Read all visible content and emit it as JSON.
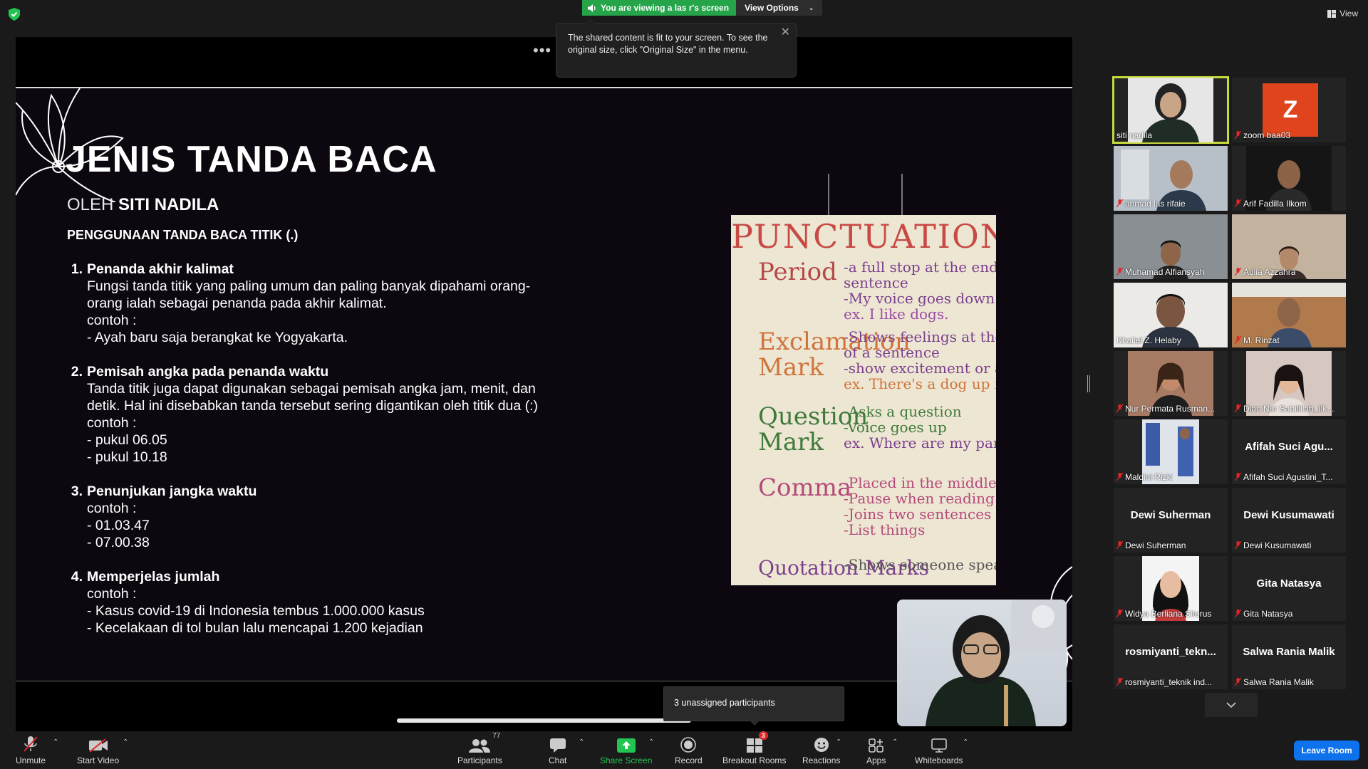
{
  "banner": {
    "viewing_text": "You are viewing a las r's screen",
    "view_options_label": "View Options",
    "view_label": "View"
  },
  "tooltip": {
    "text": "The shared content is fit to your screen. To see the original size, click \"Original Size\" in the menu."
  },
  "slide": {
    "title": "JENIS TANDA BACA",
    "author_prefix": "OLEH",
    "author_name": "SITI NADILA",
    "subtitle": "PENGGUNAAN TANDA BACA TITIK (.)",
    "items": [
      {
        "num": "1.",
        "heading": "Penanda akhir kalimat",
        "lines": [
          "Fungsi tanda titik yang paling umum dan paling banyak dipahami orang-",
          "orang ialah sebagai penanda pada akhir kalimat.",
          "contoh :",
          "- Ayah baru saja berangkat ke Yogyakarta."
        ]
      },
      {
        "num": "2.",
        "heading": "Pemisah angka pada penanda waktu",
        "lines": [
          "Tanda titik juga dapat digunakan sebagai pemisah angka jam, menit, dan",
          "detik. Hal ini disebabkan tanda tersebut sering digantikan oleh titik dua (:)",
          "contoh :",
          "- pukul 06.05",
          "- pukul 10.18"
        ]
      },
      {
        "num": "3.",
        "heading": "Penunjukan jangka waktu",
        "lines": [
          "contoh :",
          "- 01.03.47",
          "- 07.00.38"
        ]
      },
      {
        "num": "4.",
        "heading": "Memperjelas jumlah",
        "lines": [
          "contoh :",
          "- Kasus covid-19 di Indonesia tembus 1.000.000 kasus",
          "- Kecelakaan di tol bulan lalu mencapai 1.200 kejadian"
        ]
      }
    ]
  },
  "poster": {
    "heading": "PUNCTUATION",
    "rows": [
      {
        "label": "Period",
        "desc": [
          "-a full stop at the end of a",
          "sentence",
          "-My voice goes down.",
          "ex. I like dogs."
        ]
      },
      {
        "label": "Exclamation Mark",
        "desc": [
          "-Shows feelings at the e",
          "of a sentence",
          "-show excitement or ang",
          "ex. There's a dog up in that tree!"
        ]
      },
      {
        "label": "Question Mark",
        "desc": [
          "-Asks a question",
          "-Voice goes up",
          "ex. Where are my pants?"
        ]
      },
      {
        "label": "Comma",
        "desc": [
          "-Placed in the middle of a",
          "-Pause when reading",
          "-Joins two sentences",
          "-List things"
        ]
      },
      {
        "label": "Quotation Marks",
        "desc": [
          "-Shows someone speakin"
        ]
      }
    ]
  },
  "unassigned_tooltip": "3 unassigned participants",
  "participants": [
    {
      "name": "siti nadila",
      "video": true,
      "active": true
    },
    {
      "name": "zoom baa03",
      "avatar_letter": "Z"
    },
    {
      "name": "ahmad las rifaie",
      "video": true
    },
    {
      "name": "Arif Fadilla Ilkom",
      "video": true
    },
    {
      "name": "Muhamad Alfiansyah",
      "video": true
    },
    {
      "name": "Aulia Azzahra",
      "video": true
    },
    {
      "name": "Khaliel Z. Helaby",
      "video": true
    },
    {
      "name": "M. Rinzat",
      "video": true
    },
    {
      "name": "Nur Permata Rusman...",
      "video": true
    },
    {
      "name": "Dian Nur Sabilillah_Ilk...",
      "video": true
    },
    {
      "name": "Maldini Rizki",
      "video": true
    },
    {
      "name": "Afifah Suci Agustini_T...",
      "display_name": "Afifah Suci Agu..."
    },
    {
      "name": "Dewi Suherman",
      "display_name": "Dewi Suherman"
    },
    {
      "name": "Dewi Kusumawati",
      "display_name": "Dewi Kusumawati"
    },
    {
      "name": "Widya Berliana Sitorus",
      "video": true
    },
    {
      "name": "Gita Natasya",
      "display_name": "Gita Natasya"
    },
    {
      "name": "rosmiyanti_teknik ind...",
      "display_name": "rosmiyanti_tekn..."
    },
    {
      "name": "Salwa Rania Malik",
      "display_name": "Salwa Rania Malik"
    }
  ],
  "toolbar": {
    "unmute": "Unmute",
    "start_video": "Start Video",
    "participants": "Participants",
    "participants_count": "77",
    "chat": "Chat",
    "share_screen": "Share Screen",
    "record": "Record",
    "breakout_rooms": "Breakout Rooms",
    "breakout_badge": "3",
    "reactions": "Reactions",
    "apps": "Apps",
    "whiteboards": "Whiteboards",
    "leave_room": "Leave Room"
  },
  "colors": {
    "share_green": "#26a44a",
    "leave_blue": "#0e72ed",
    "active_speaker": "#c8d93a",
    "mic_off_red": "#e02828",
    "avatar_orange": "#e0441c"
  }
}
